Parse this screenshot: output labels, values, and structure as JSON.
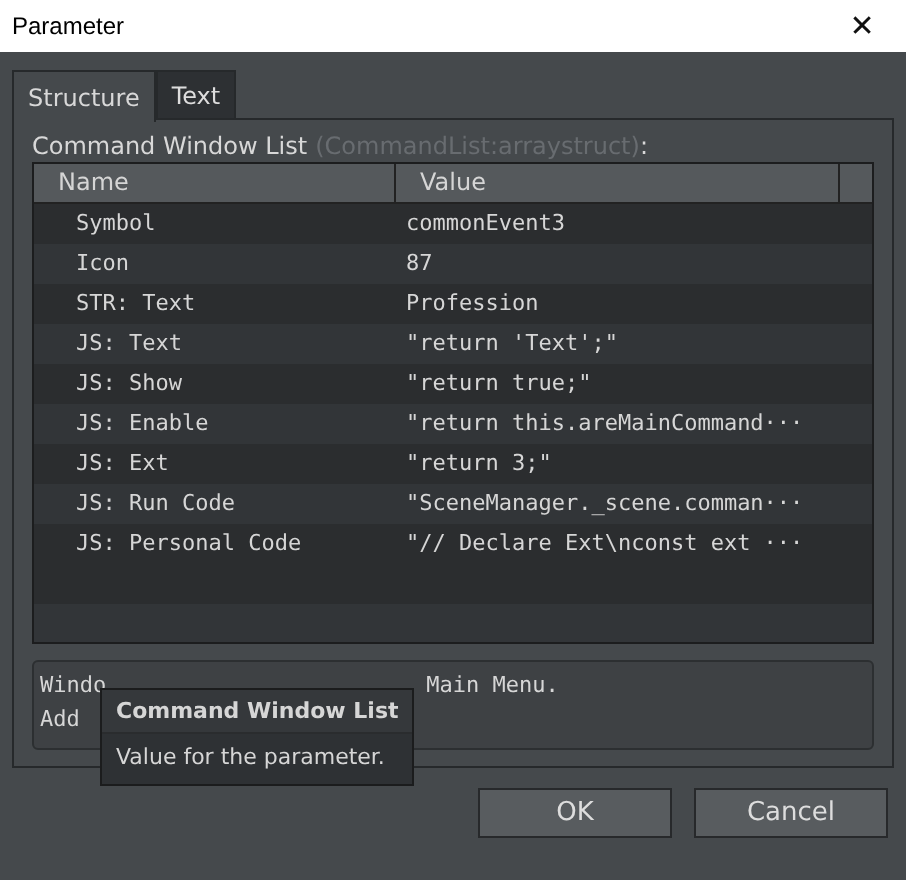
{
  "window": {
    "title": "Parameter",
    "close": "✕"
  },
  "tabs": [
    {
      "label": "Structure",
      "selected": true
    },
    {
      "label": "Text",
      "selected": false
    }
  ],
  "list": {
    "label": "Command Window List",
    "type": "(CommandList:arraystruct)",
    "suffix": ":",
    "columns": [
      "Name",
      "Value"
    ],
    "rows": [
      {
        "name": "Symbol",
        "value": "commonEvent3"
      },
      {
        "name": "Icon",
        "value": "87"
      },
      {
        "name": "STR: Text",
        "value": "Profession"
      },
      {
        "name": "JS: Text",
        "value": "\"return 'Text';\""
      },
      {
        "name": "JS: Show",
        "value": "\"return true;\""
      },
      {
        "name": "JS: Enable",
        "value": "\"return this.areMainCommand···"
      },
      {
        "name": "JS: Ext",
        "value": "\"return 3;\""
      },
      {
        "name": "JS: Run Code",
        "value": "\"SceneManager._scene.comman···"
      },
      {
        "name": "JS: Personal Code",
        "value": "\"// Declare Ext\\nconst ext ···"
      }
    ]
  },
  "description": {
    "line_1_start": "Windo",
    "line_1_end": "Main Menu.",
    "line_2": "Add"
  },
  "tooltip": {
    "title": "Command Window List",
    "text": "Value for the parameter."
  },
  "buttons": [
    "OK",
    "Cancel"
  ]
}
